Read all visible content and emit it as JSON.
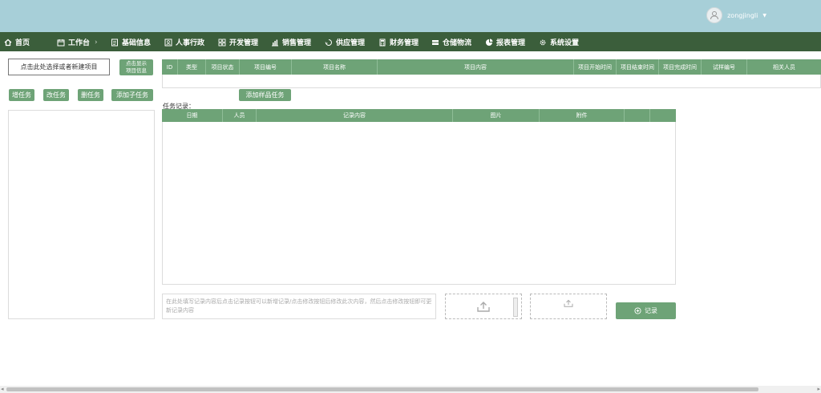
{
  "user": {
    "name": "zongjingli"
  },
  "nav": {
    "home": "首页",
    "workbench": "工作台",
    "workbench_chevron": "›",
    "basic_info": "基础信息",
    "hr_admin": "人事行政",
    "dev_mgmt": "开发管理",
    "sales_mgmt": "销售管理",
    "supply": "供应管理",
    "finance": "财务管理",
    "warehouse": "仓储物流",
    "reports": "报表管理",
    "settings": "系统设置"
  },
  "left": {
    "select_project": "点击此处选择或者新建项目",
    "show_info_line1": "点击显示",
    "show_info_line2": "项目信息",
    "add_task": "增任务",
    "edit_task": "改任务",
    "delete_task": "删任务",
    "add_subtask": "添加子任务"
  },
  "project_table": {
    "headers": [
      "ID",
      "类型",
      "项目状态",
      "项目编号",
      "项目名称",
      "项目内容",
      "项目开始时间",
      "项目结束时间",
      "项目完成时间",
      "试样编号",
      "相关人员"
    ]
  },
  "sample_task_button": "添加样品任务",
  "records": {
    "title": "任务记录：",
    "headers": [
      "日期",
      "人员",
      "记录内容",
      "图片",
      "附件",
      "",
      ""
    ]
  },
  "note": {
    "placeholder": "在此处填写记录内容后点击记录按钮可以新增记录/点击修改按钮后修改此次内容，然后点击修改按钮即可更新记录内容"
  },
  "record_button": "记录"
}
